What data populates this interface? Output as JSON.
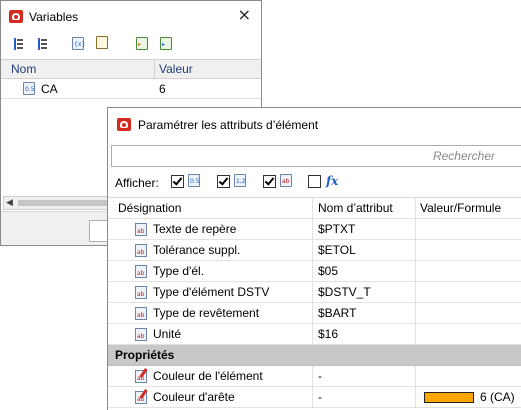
{
  "colors": {
    "app_icon": "#d52b1e",
    "header_text": "#1d3c7a",
    "section_bg": "#c8c8c8",
    "edge_color_swatch": "#ffa500"
  },
  "variables_window": {
    "title": "Variables",
    "close_icon": "×",
    "toolbar": {
      "buttons": [
        "sort-ascending-icon",
        "sort-descending-icon",
        "variable-icon",
        "clipboard-icon",
        "import-icon",
        "export-icon"
      ]
    },
    "table": {
      "headers": {
        "name": "Nom",
        "value": "Valeur"
      },
      "rows": [
        {
          "icon": "variable-icon",
          "name": "CA",
          "value": "6"
        }
      ]
    }
  },
  "attributes_window": {
    "title": "Paramétrer les attributs d’élément",
    "search": {
      "placeholder": "Rechercher"
    },
    "afficher": {
      "label": "Afficher:",
      "filters": [
        {
          "icon": "attribute-text-icon",
          "checked": true
        },
        {
          "icon": "attribute-number-icon",
          "checked": true
        },
        {
          "icon": "attribute-list-icon",
          "checked": true
        },
        {
          "icon": "formula-icon",
          "checked": false
        }
      ]
    },
    "table": {
      "headers": {
        "designation": "Désignation",
        "attr_name": "Nom d’attribut",
        "value_formula": "Valeur/Formule"
      },
      "rows": [
        {
          "designation": "Texte de repère",
          "attr_name": "$PTXT",
          "value": ""
        },
        {
          "designation": "Tolérance suppl.",
          "attr_name": "$ETOL",
          "value": ""
        },
        {
          "designation": "Type d'él.",
          "attr_name": "$05",
          "value": ""
        },
        {
          "designation": "Type d'élément DSTV",
          "attr_name": "$DSTV_T",
          "value": ""
        },
        {
          "designation": "Type de revêtement",
          "attr_name": "$BART",
          "value": ""
        },
        {
          "designation": "Unité",
          "attr_name": "$16",
          "value": ""
        }
      ],
      "section": "Propriétés",
      "property_rows": [
        {
          "designation": "Couleur de l'élément",
          "attr_name": "-",
          "value": ""
        },
        {
          "designation": "Couleur d'arête",
          "attr_name": "-",
          "value": "6 (CA)"
        }
      ]
    }
  }
}
